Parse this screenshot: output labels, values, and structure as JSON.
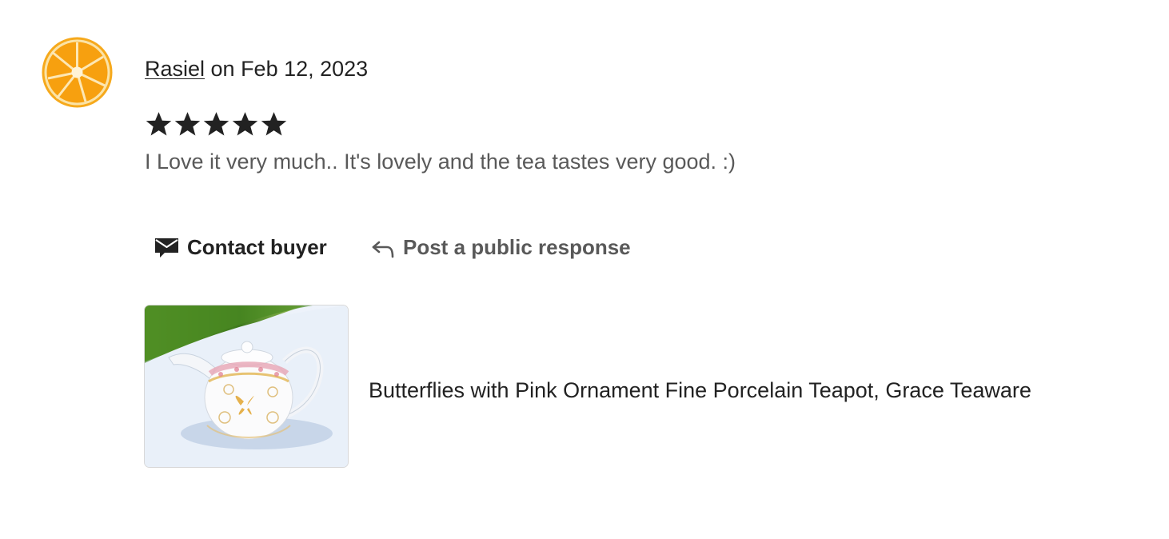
{
  "review": {
    "reviewer_name": "Rasiel",
    "date_text": " on Feb 12, 2023",
    "rating": 5,
    "rating_max": 5,
    "text": "I Love it very much.. It's lovely and the tea tastes very good. :)"
  },
  "actions": {
    "contact_label": "Contact buyer",
    "respond_label": "Post a public response"
  },
  "product": {
    "title": "Butterflies with Pink Ornament Fine Porcelain Teapot, Grace Teaware"
  },
  "icons": {
    "avatar": "orange-slice-avatar",
    "star": "star-icon",
    "contact": "envelope-icon",
    "respond": "reply-arrow-icon"
  },
  "colors": {
    "text_primary": "#222222",
    "text_secondary": "#595959",
    "star": "#222222",
    "avatar_orange": "#f5a30b"
  }
}
